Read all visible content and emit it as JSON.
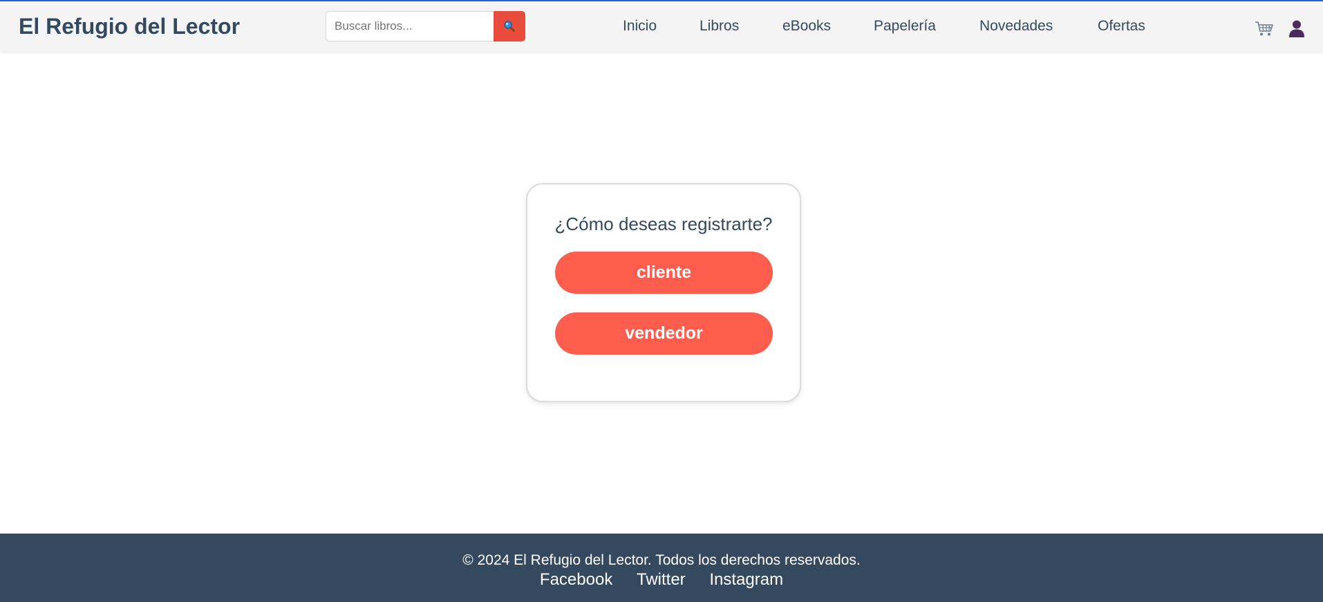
{
  "header": {
    "brand": "El Refugio del Lector",
    "search": {
      "placeholder": "Buscar libros...",
      "value": ""
    },
    "nav": {
      "inicio": "Inicio",
      "libros": "Libros",
      "ebooks": "eBooks",
      "papeleria": "Papelería",
      "novedades": "Novedades",
      "ofertas": "Ofertas"
    },
    "icons": {
      "search": "search-icon",
      "cart": "cart-icon",
      "user": "user-icon"
    }
  },
  "main": {
    "question": "¿Cómo deseas registrarte?",
    "options": {
      "cliente": "cliente",
      "vendedor": "vendedor"
    }
  },
  "footer": {
    "copyright": "© 2024 El Refugio del Lector. Todos los derechos reservados.",
    "social": {
      "facebook": "Facebook",
      "twitter": "Twitter",
      "instagram": "Instagram"
    }
  },
  "colors": {
    "primary_text": "#34495e",
    "accent": "#ff5e4f",
    "search_button": "#e74c3c",
    "footer_bg": "#34495e",
    "header_bg": "#f4f4f4",
    "top_line": "#2b5fd9"
  }
}
